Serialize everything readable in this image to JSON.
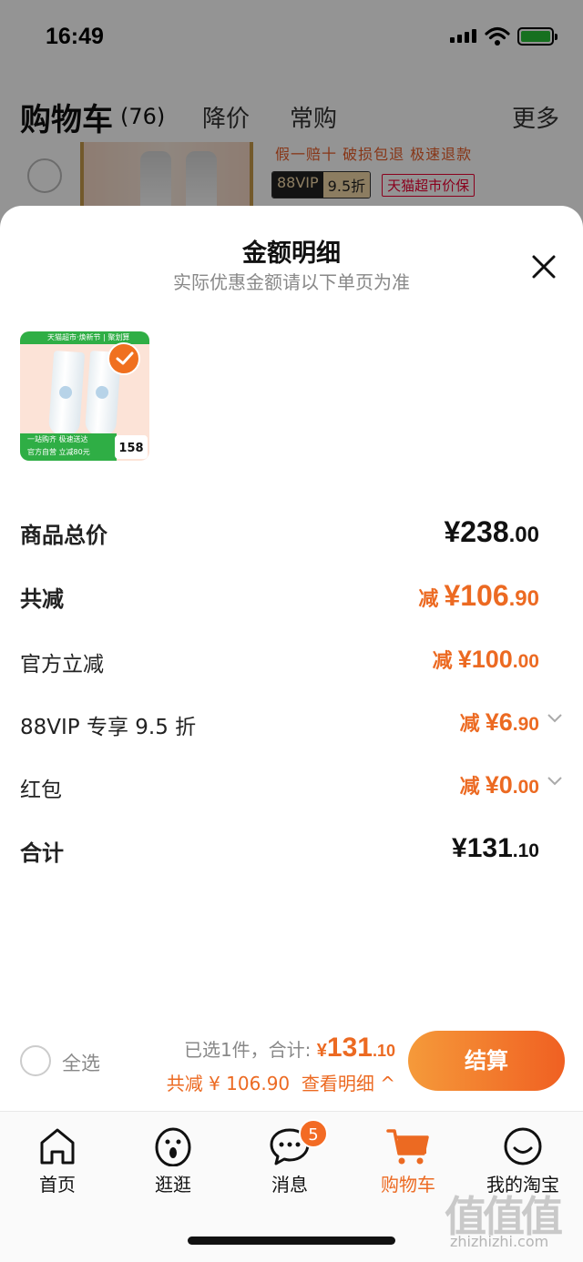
{
  "status": {
    "time": "16:49"
  },
  "cart": {
    "title": "购物车",
    "count": "(76)",
    "tab_price_drop": "降价",
    "tab_frequent": "常购",
    "tab_more": "更多",
    "item_tags": "假一赔十  破损包退  极速退款",
    "vip_left": "88VIP",
    "vip_right": "9.5折",
    "tmall_tag": "天猫超市价保"
  },
  "sheet": {
    "title": "金额明细",
    "subtitle": "实际优惠金额请以下单页为准",
    "product": {
      "top_text": "天猫超市·焕新节 | 聚划算",
      "bar_line1": "一站购齐 极速送达",
      "bar_line2": "官方自营 立减80元",
      "price": "158"
    },
    "rows": [
      {
        "label": "商品总价",
        "prefix": "",
        "int": "¥238",
        "dec": ".00"
      },
      {
        "label": "共减",
        "prefix": "减 ",
        "int": "¥106",
        "dec": ".90"
      },
      {
        "label": "官方立减",
        "prefix": "减 ",
        "int": "¥100",
        "dec": ".00"
      },
      {
        "label": "88VIP 专享 9.5 折",
        "prefix": "减 ",
        "int": "¥6",
        "dec": ".90"
      },
      {
        "label": "红包",
        "prefix": "减 ",
        "int": "¥0",
        "dec": ".00"
      },
      {
        "label": "合计",
        "prefix": "",
        "int": "¥131",
        "dec": ".10"
      }
    ]
  },
  "bottom": {
    "select_all": "全选",
    "selected_text": "已选1件，合计: ",
    "total_symbol": "¥",
    "total_int": "131",
    "total_dec": ".10",
    "reduced": "共减 ¥ 106.90",
    "view_detail": "查看明细 ^",
    "checkout": "结算"
  },
  "tabbar": {
    "home": "首页",
    "browse": "逛逛",
    "messages": "消息",
    "messages_badge": "5",
    "cart": "购物车",
    "mine": "我的淘宝"
  },
  "colors": {
    "accent": "#ec6a22",
    "vip_gold": "#f1d7a8"
  },
  "watermark": {
    "glyphs": "值值值",
    "domain": "zhizhizhi.com"
  }
}
